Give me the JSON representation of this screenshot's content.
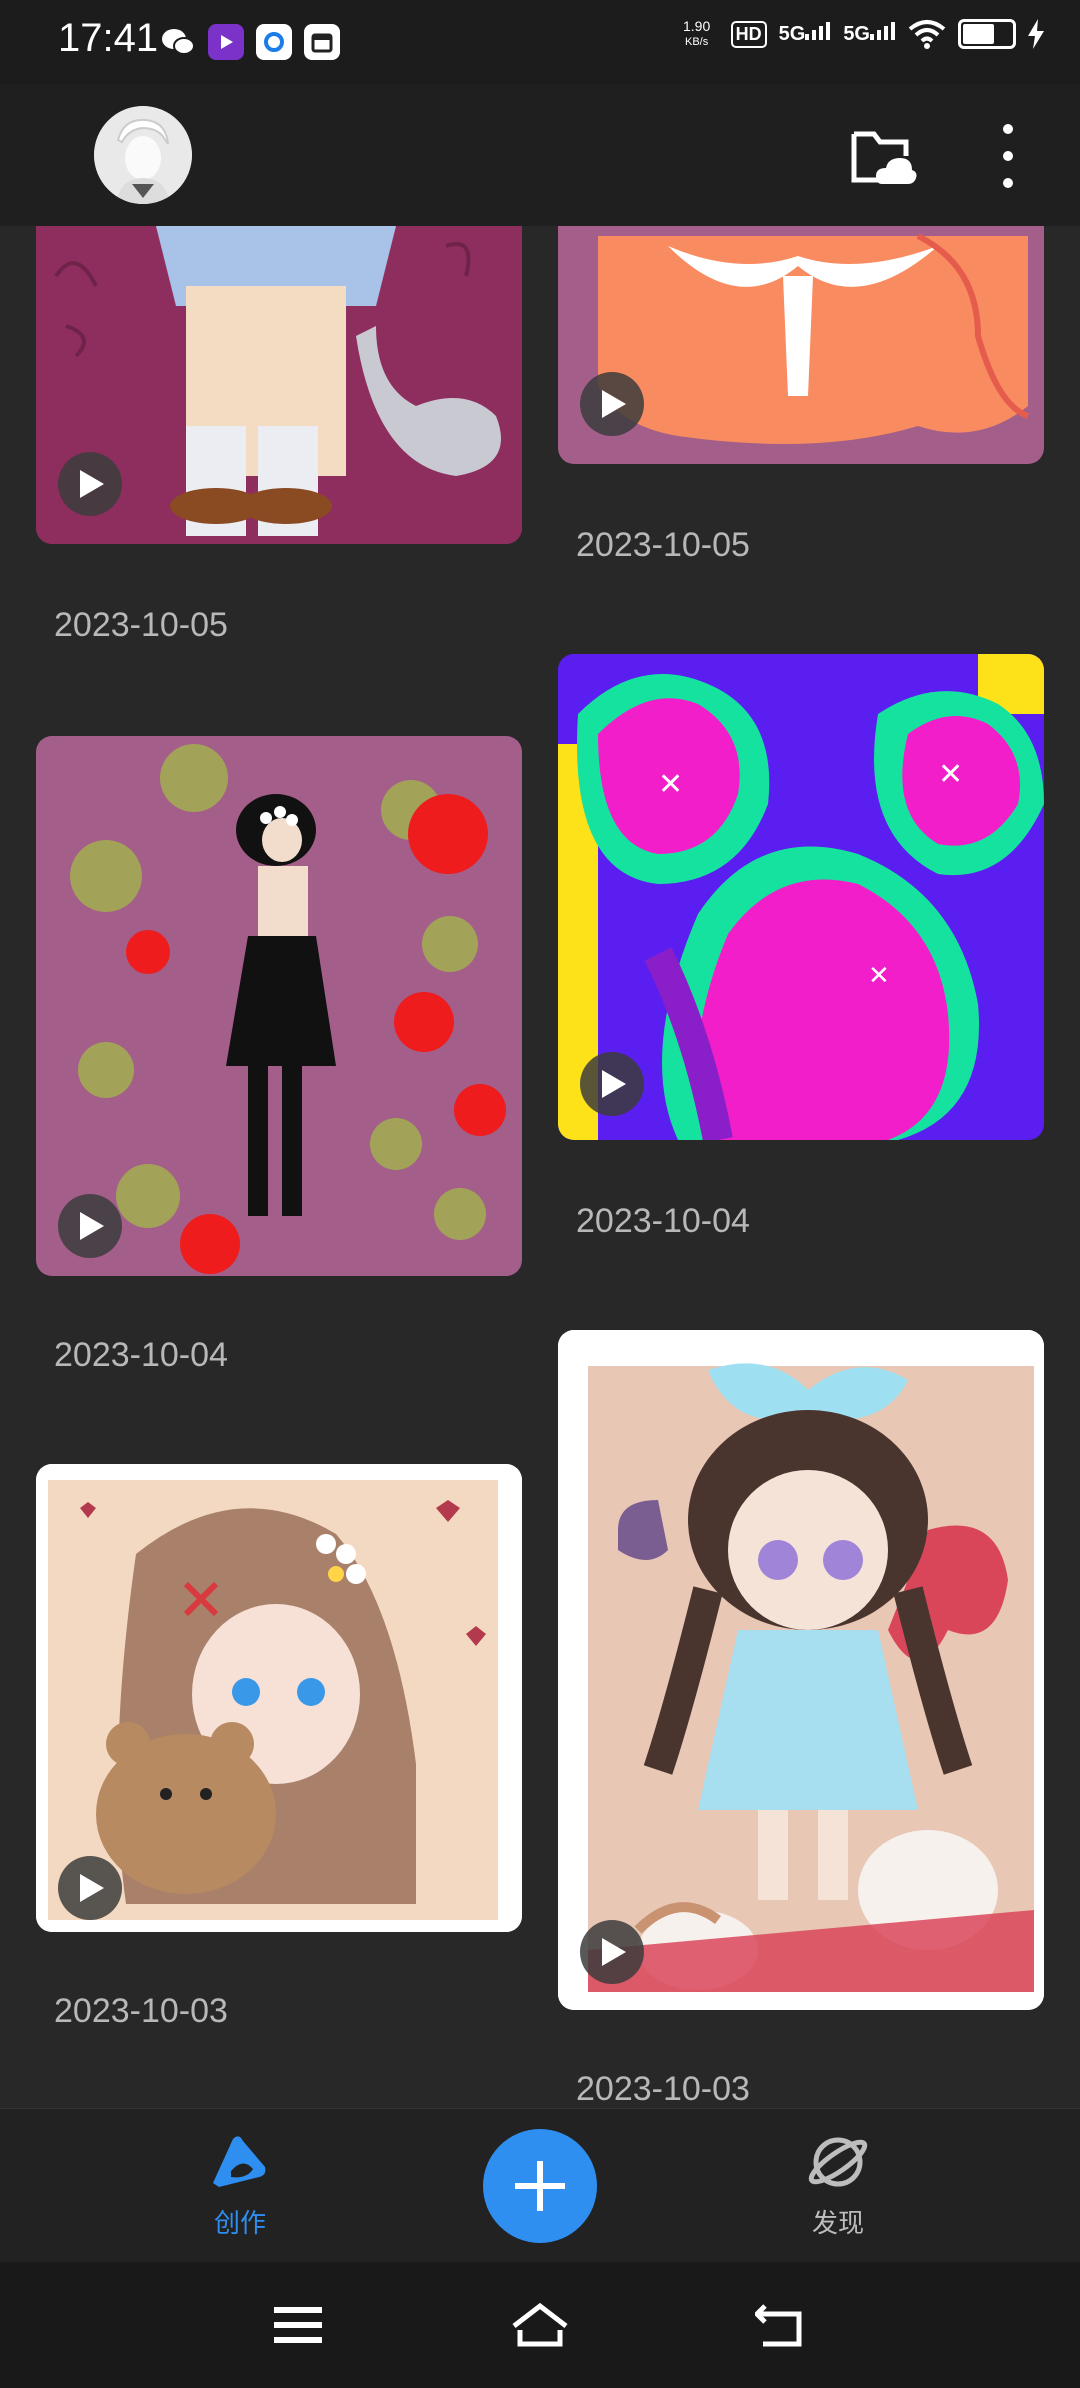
{
  "status_bar": {
    "time": "17:41",
    "net_speed_value": "1.90",
    "net_speed_unit": "KB/s",
    "hd_label": "HD",
    "signal1": "5G",
    "signal2": "5G",
    "battery_level": 0.6
  },
  "top_bar": {
    "avatar_icon": "avatar-icon",
    "cloud_icon": "cloud-folder-icon",
    "more_icon": "more-vertical-icon"
  },
  "feed": {
    "items": [
      {
        "date": "2023-10-05",
        "subject": "girl with cat tail"
      },
      {
        "date": "2023-10-05",
        "subject": "orange dress"
      },
      {
        "date": "2023-10-04",
        "subject": "girl in black dress with polka dots"
      },
      {
        "date": "2023-10-04",
        "subject": "colorful paw pattern"
      },
      {
        "date": "2023-10-03",
        "subject": "girl with teddy bear"
      },
      {
        "date": "2023-10-03",
        "subject": "girl with blue bow and cats"
      }
    ]
  },
  "bottom_nav": {
    "create_label": "创作",
    "discover_label": "发现",
    "accent": "#2e8ff0"
  }
}
